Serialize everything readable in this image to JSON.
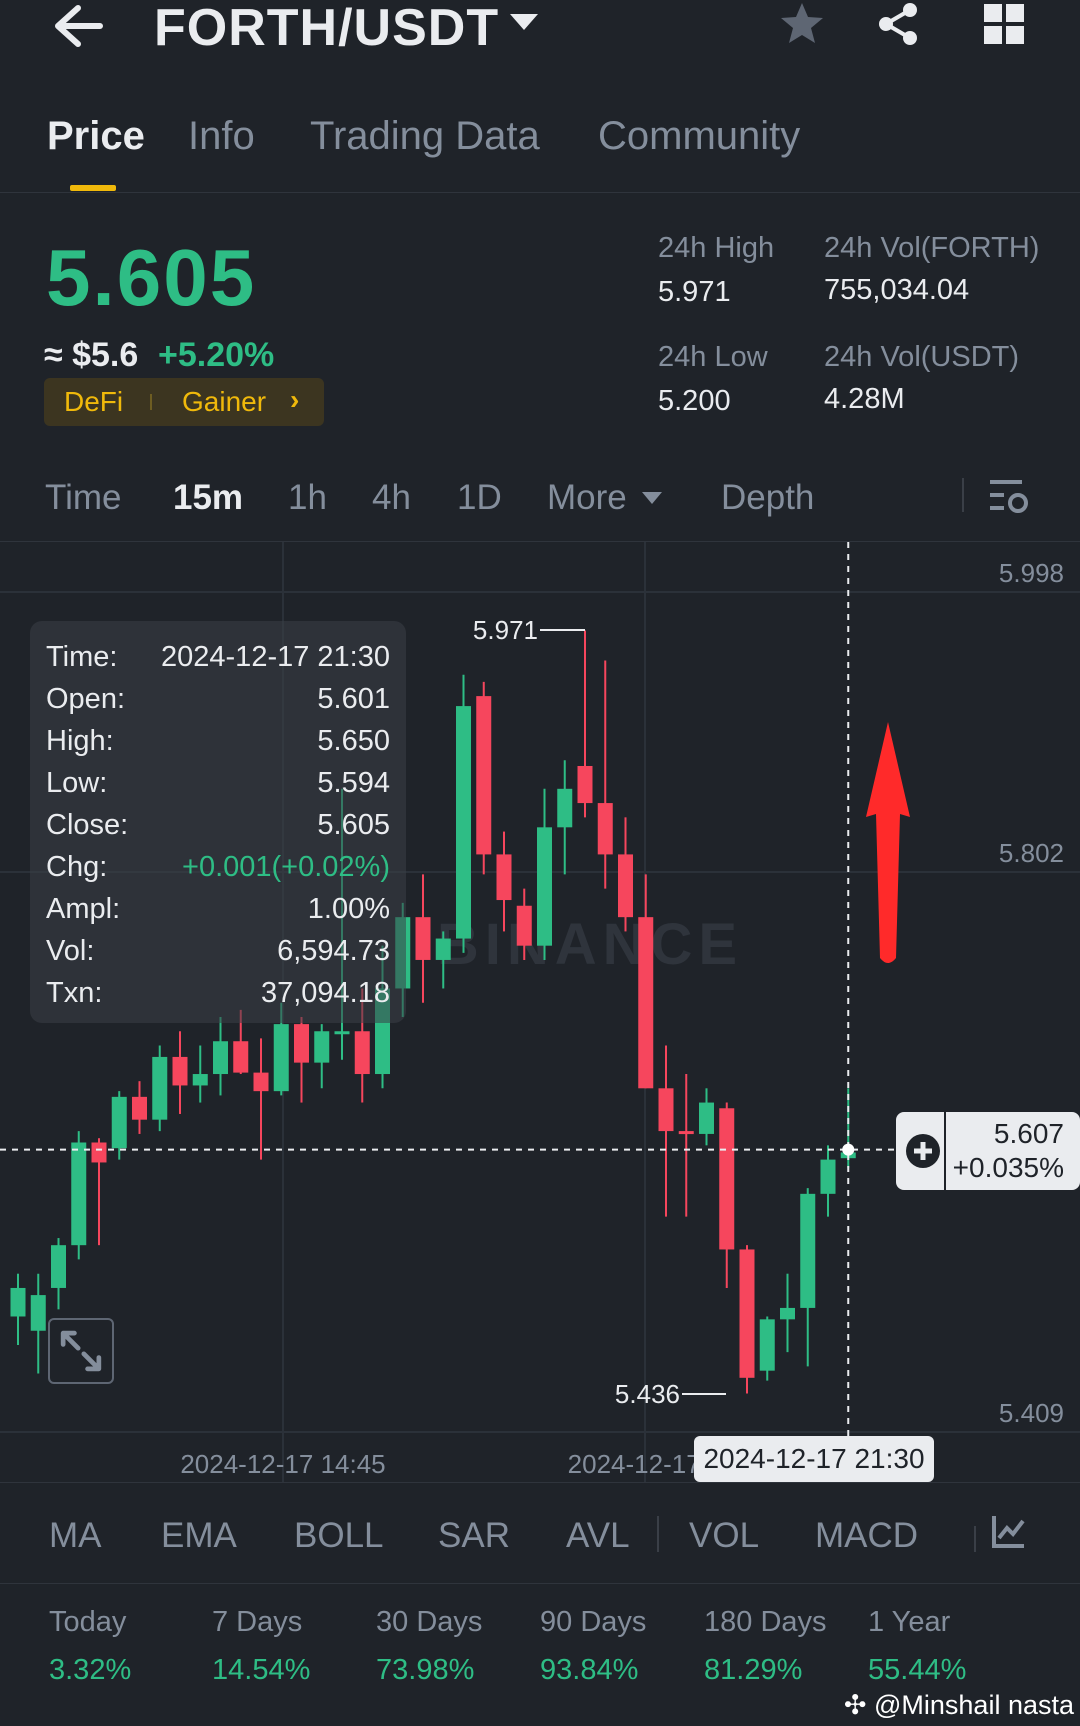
{
  "header": {
    "pair": "FORTH/USDT",
    "icons": [
      "back-arrow-icon",
      "caret-down-icon",
      "star-icon",
      "share-icon",
      "grid-icon"
    ]
  },
  "tabs": [
    {
      "label": "Price",
      "active": true
    },
    {
      "label": "Info"
    },
    {
      "label": "Trading Data"
    },
    {
      "label": "Community"
    }
  ],
  "summary": {
    "price": "5.605",
    "approx": "≈ $5.6",
    "change": "+5.20%",
    "tags": [
      "DeFi",
      "Gainer"
    ],
    "high_label": "24h High",
    "high_value": "5.971",
    "low_label": "24h Low",
    "low_value": "5.200",
    "vol_forth_label": "24h Vol(FORTH)",
    "vol_forth_value": "755,034.04",
    "vol_usdt_label": "24h Vol(USDT)",
    "vol_usdt_value": "4.28M"
  },
  "intervals": {
    "items": [
      "Time",
      "15m",
      "1h",
      "4h",
      "1D",
      "More",
      "Depth"
    ],
    "active": "15m"
  },
  "tooltip": {
    "rows": [
      {
        "k": "Time:",
        "v": "2024-12-17 21:30"
      },
      {
        "k": "Open:",
        "v": "5.601"
      },
      {
        "k": "High:",
        "v": "5.650"
      },
      {
        "k": "Low:",
        "v": "5.594"
      },
      {
        "k": "Close:",
        "v": "5.605"
      },
      {
        "k": "Chg:",
        "v": "+0.001(+0.02%)"
      },
      {
        "k": "Ampl:",
        "v": "1.00%"
      },
      {
        "k": "Vol:",
        "v": "6,594.73"
      },
      {
        "k": "Txn:",
        "v": "37,094.18"
      }
    ]
  },
  "chart_data": {
    "type": "candlestick",
    "interval": "15m",
    "y_axis_ticks": [
      "5.998",
      "5.802",
      "5.409"
    ],
    "x_axis_ticks": [
      "2024-12-17 14:45",
      "2024-12-17 1"
    ],
    "high_marker": "5.971",
    "low_marker": "5.436",
    "current_price": "5.607",
    "current_change": "+0.035%",
    "crosshair_time": "2024-12-17 21:30",
    "watermark": "BINANCE",
    "colors": {
      "up": "#2ebd85",
      "down": "#f6465d",
      "arrow": "#ff2a2a"
    },
    "candles": [
      {
        "o": 5.49,
        "h": 5.52,
        "l": 5.47,
        "c": 5.51
      },
      {
        "o": 5.48,
        "h": 5.52,
        "l": 5.45,
        "c": 5.505
      },
      {
        "o": 5.51,
        "h": 5.545,
        "l": 5.495,
        "c": 5.54
      },
      {
        "o": 5.54,
        "h": 5.62,
        "l": 5.53,
        "c": 5.612
      },
      {
        "o": 5.612,
        "h": 5.615,
        "l": 5.54,
        "c": 5.598
      },
      {
        "o": 5.608,
        "h": 5.648,
        "l": 5.6,
        "c": 5.644
      },
      {
        "o": 5.644,
        "h": 5.655,
        "l": 5.618,
        "c": 5.628
      },
      {
        "o": 5.628,
        "h": 5.68,
        "l": 5.62,
        "c": 5.672
      },
      {
        "o": 5.672,
        "h": 5.69,
        "l": 5.632,
        "c": 5.652
      },
      {
        "o": 5.652,
        "h": 5.68,
        "l": 5.64,
        "c": 5.66
      },
      {
        "o": 5.66,
        "h": 5.7,
        "l": 5.645,
        "c": 5.683
      },
      {
        "o": 5.683,
        "h": 5.705,
        "l": 5.66,
        "c": 5.661
      },
      {
        "o": 5.661,
        "h": 5.685,
        "l": 5.6,
        "c": 5.648
      },
      {
        "o": 5.648,
        "h": 5.71,
        "l": 5.645,
        "c": 5.695
      },
      {
        "o": 5.695,
        "h": 5.7,
        "l": 5.64,
        "c": 5.668
      },
      {
        "o": 5.668,
        "h": 5.695,
        "l": 5.65,
        "c": 5.69
      },
      {
        "o": 5.69,
        "h": 5.86,
        "l": 5.67,
        "c": 5.69
      },
      {
        "o": 5.69,
        "h": 5.72,
        "l": 5.64,
        "c": 5.66
      },
      {
        "o": 5.66,
        "h": 5.75,
        "l": 5.65,
        "c": 5.72
      },
      {
        "o": 5.72,
        "h": 5.78,
        "l": 5.7,
        "c": 5.77
      },
      {
        "o": 5.77,
        "h": 5.8,
        "l": 5.71,
        "c": 5.74
      },
      {
        "o": 5.74,
        "h": 5.76,
        "l": 5.72,
        "c": 5.755
      },
      {
        "o": 5.755,
        "h": 5.94,
        "l": 5.745,
        "c": 5.918
      },
      {
        "o": 5.925,
        "h": 5.935,
        "l": 5.8,
        "c": 5.814
      },
      {
        "o": 5.814,
        "h": 5.83,
        "l": 5.76,
        "c": 5.782
      },
      {
        "o": 5.778,
        "h": 5.79,
        "l": 5.74,
        "c": 5.75
      },
      {
        "o": 5.75,
        "h": 5.86,
        "l": 5.74,
        "c": 5.833
      },
      {
        "o": 5.833,
        "h": 5.88,
        "l": 5.8,
        "c": 5.86
      },
      {
        "o": 5.876,
        "h": 5.971,
        "l": 5.84,
        "c": 5.85
      },
      {
        "o": 5.85,
        "h": 5.95,
        "l": 5.79,
        "c": 5.814
      },
      {
        "o": 5.814,
        "h": 5.84,
        "l": 5.76,
        "c": 5.77
      },
      {
        "o": 5.77,
        "h": 5.8,
        "l": 5.65,
        "c": 5.65
      },
      {
        "o": 5.65,
        "h": 5.68,
        "l": 5.56,
        "c": 5.62
      },
      {
        "o": 5.62,
        "h": 5.66,
        "l": 5.56,
        "c": 5.618
      },
      {
        "o": 5.618,
        "h": 5.65,
        "l": 5.61,
        "c": 5.64
      },
      {
        "o": 5.636,
        "h": 5.64,
        "l": 5.51,
        "c": 5.537
      },
      {
        "o": 5.537,
        "h": 5.54,
        "l": 5.436,
        "c": 5.447
      },
      {
        "o": 5.452,
        "h": 5.49,
        "l": 5.445,
        "c": 5.488
      },
      {
        "o": 5.488,
        "h": 5.52,
        "l": 5.465,
        "c": 5.496
      },
      {
        "o": 5.496,
        "h": 5.58,
        "l": 5.455,
        "c": 5.576
      },
      {
        "o": 5.576,
        "h": 5.61,
        "l": 5.56,
        "c": 5.6
      },
      {
        "o": 5.601,
        "h": 5.65,
        "l": 5.594,
        "c": 5.605
      }
    ]
  },
  "indicators": [
    "MA",
    "EMA",
    "BOLL",
    "SAR",
    "AVL",
    "VOL",
    "MACD"
  ],
  "performance": [
    {
      "label": "Today",
      "value": "3.32%"
    },
    {
      "label": "7 Days",
      "value": "14.54%"
    },
    {
      "label": "30 Days",
      "value": "73.98%"
    },
    {
      "label": "90 Days",
      "value": "93.84%"
    },
    {
      "label": "180 Days",
      "value": "81.29%"
    },
    {
      "label": "1 Year",
      "value": "55.44%"
    }
  ],
  "watermark_user": "@Minshail nasta"
}
